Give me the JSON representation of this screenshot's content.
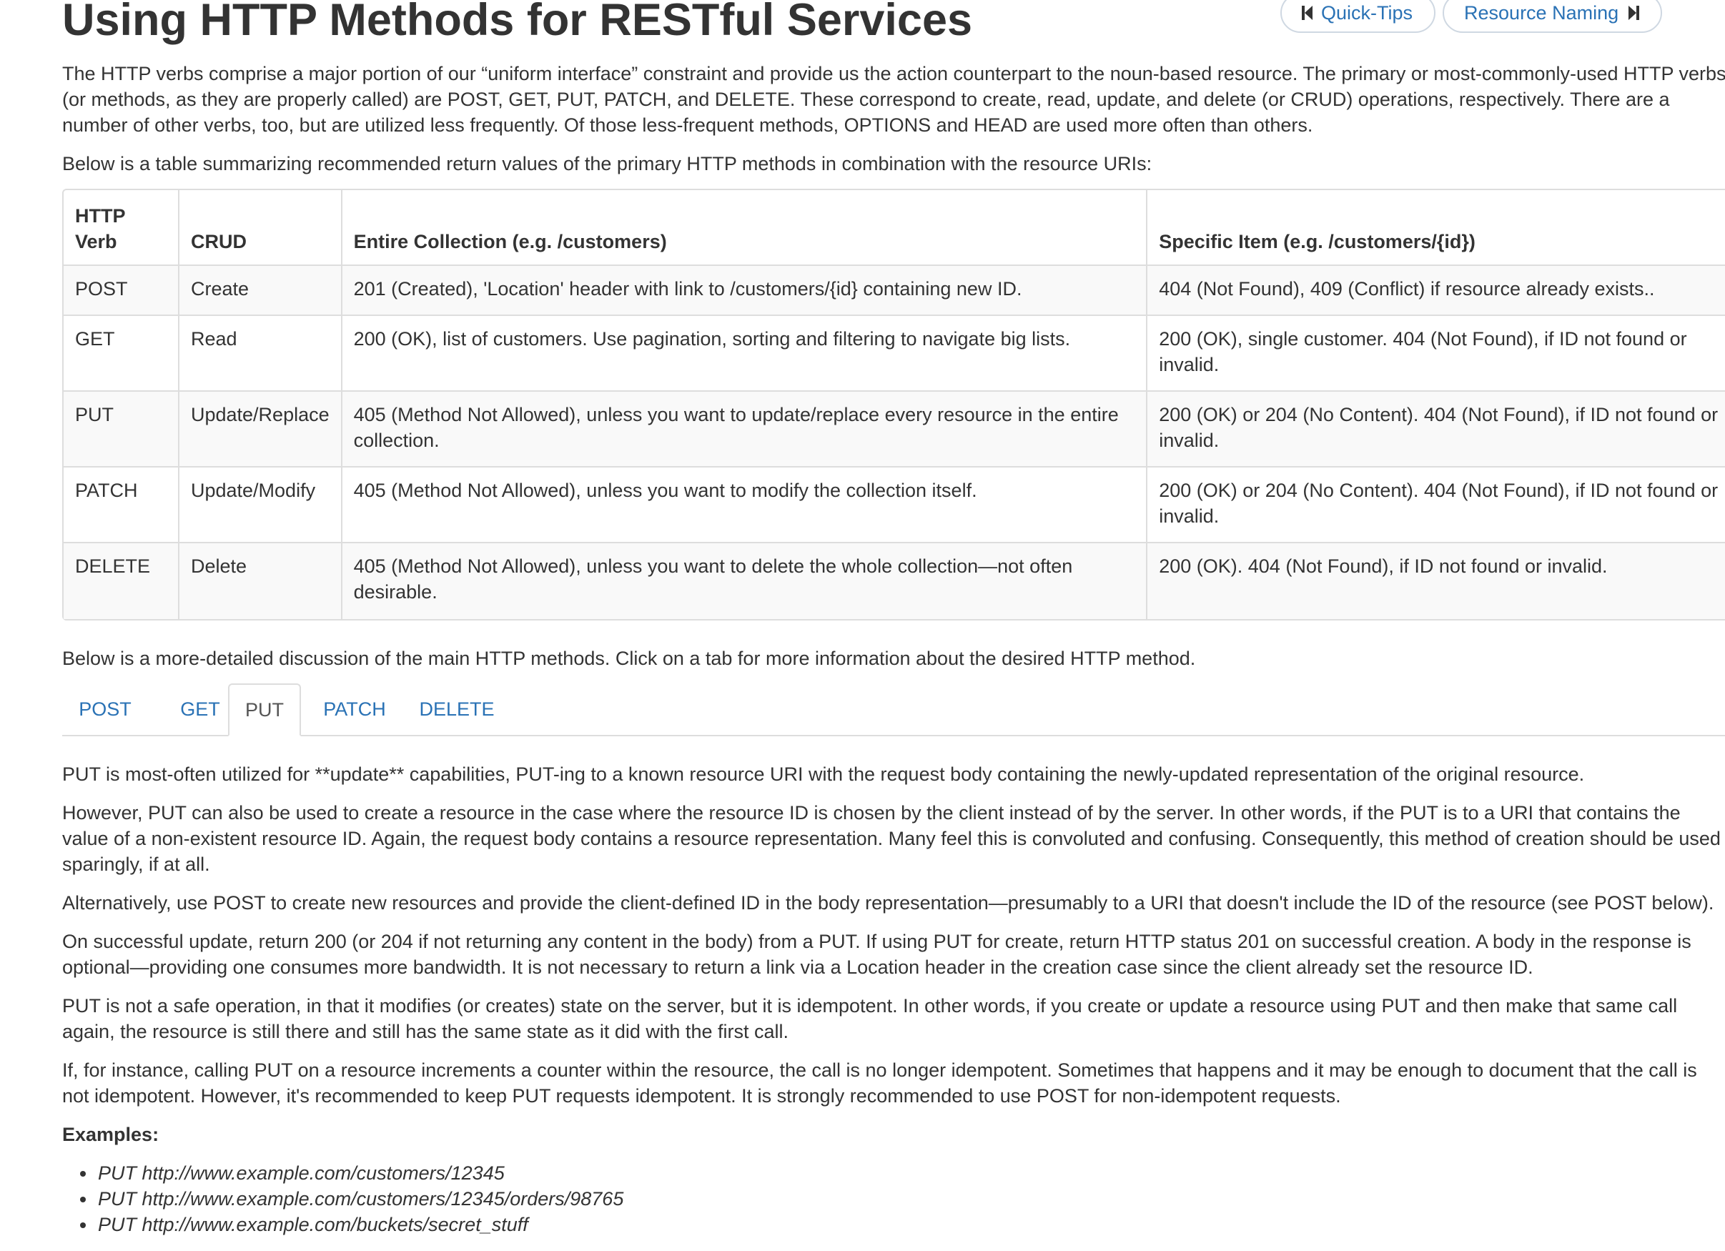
{
  "page": {
    "title": "Using HTTP Methods for RESTful Services"
  },
  "nav": {
    "prev_label": "Quick-Tips",
    "prev_icon": "skip-back-icon",
    "next_label": "Resource Naming",
    "next_icon": "skip-forward-icon"
  },
  "intro": {
    "p1": "The HTTP verbs comprise a major portion of our “uniform interface” constraint and provide us the action counterpart to the noun-based resource. The primary or most-commonly-used HTTP verbs (or methods, as they are properly called) are POST, GET, PUT, PATCH, and DELETE. These correspond to create, read, update, and delete (or CRUD) operations, respectively. There are a number of other verbs, too, but are utilized less frequently. Of those less-frequent methods, OPTIONS and HEAD are used more often than others.",
    "p2": "Below is a table summarizing recommended return values of the primary HTTP methods in combination with the resource URIs:"
  },
  "table": {
    "headers": [
      "HTTP Verb",
      "CRUD",
      "Entire Collection (e.g. /customers)",
      "Specific Item (e.g. /customers/{id})"
    ],
    "rows": [
      [
        "POST",
        "Create",
        "201 (Created), 'Location' header with link to /customers/{id} containing new ID.",
        "404 (Not Found), 409 (Conflict) if resource already exists.."
      ],
      [
        "GET",
        "Read",
        "200 (OK), list of customers. Use pagination, sorting and filtering to navigate big lists.",
        "200 (OK), single customer. 404 (Not Found), if ID not found or invalid."
      ],
      [
        "PUT",
        "Update/Replace",
        "405 (Method Not Allowed), unless you want to update/replace every resource in the entire collection.",
        "200 (OK) or 204 (No Content). 404 (Not Found), if ID not found or invalid."
      ],
      [
        "PATCH",
        "Update/Modify",
        "405 (Method Not Allowed), unless you want to modify the collection itself.",
        "200 (OK) or 204 (No Content). 404 (Not Found), if ID not found or invalid."
      ],
      [
        "DELETE",
        "Delete",
        "405 (Method Not Allowed), unless you want to delete the whole collection—not often desirable.",
        "200 (OK). 404 (Not Found), if ID not found or invalid."
      ]
    ]
  },
  "discussion_intro": "Below is a more-detailed discussion of the main HTTP methods. Click on a tab for more information about the desired HTTP method.",
  "tabs": [
    {
      "label": "POST",
      "active": false
    },
    {
      "label": "GET",
      "active": false
    },
    {
      "label": "PUT",
      "active": true
    },
    {
      "label": "PATCH",
      "active": false
    },
    {
      "label": "DELETE",
      "active": false
    }
  ],
  "put_content": {
    "p1": "PUT is most-often utilized for **update** capabilities, PUT-ing to a known resource URI with the request body containing the newly-updated representation of the original resource.",
    "p2": "However, PUT can also be used to create a resource in the case where the resource ID is chosen by the client instead of by the server. In other words, if the PUT is to a URI that contains the value of a non-existent resource ID. Again, the request body contains a resource representation. Many feel this is convoluted and confusing. Consequently, this method of creation should be used sparingly, if at all.",
    "p3": "Alternatively, use POST to create new resources and provide the client-defined ID in the body representation—presumably to a URI that doesn't include the ID of the resource (see POST below).",
    "p4": "On successful update, return 200 (or 204 if not returning any content in the body) from a PUT. If using PUT for create, return HTTP status 201 on successful creation. A body in the response is optional—providing one consumes more bandwidth. It is not necessary to return a link via a Location header in the creation case since the client already set the resource ID.",
    "p5": "PUT is not a safe operation, in that it modifies (or creates) state on the server, but it is idempotent. In other words, if you create or update a resource using PUT and then make that same call again, the resource is still there and still has the same state as it did with the first call.",
    "p6": "If, for instance, calling PUT on a resource increments a counter within the resource, the call is no longer idempotent. Sometimes that happens and it may be enough to document that the call is not idempotent. However, it's recommended to keep PUT requests idempotent. It is strongly recommended to use POST for non-idempotent requests.",
    "examples_label": "Examples:",
    "examples": [
      "PUT http://www.example.com/customers/12345",
      "PUT http://www.example.com/customers/12345/orders/98765",
      "PUT http://www.example.com/buckets/secret_stuff"
    ]
  },
  "colors": {
    "link": "#2a72b5",
    "text": "#333333",
    "border": "#dddddd",
    "stripe": "#f9f9f9"
  }
}
